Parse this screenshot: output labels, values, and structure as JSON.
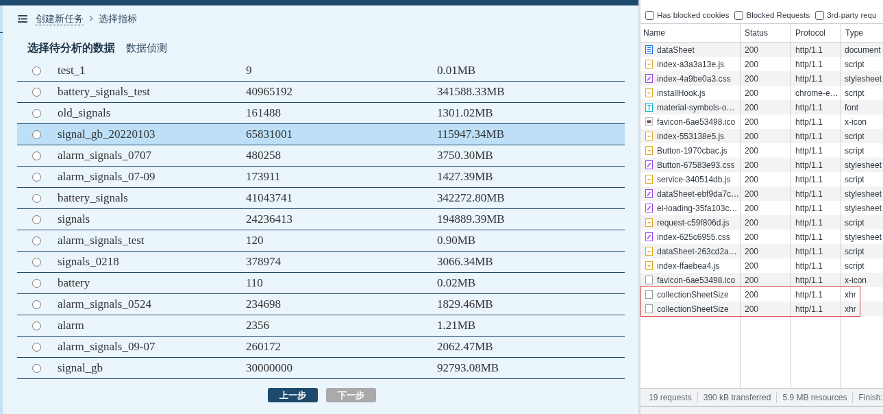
{
  "breadcrumb": [
    {
      "label": "创建新任务",
      "kind": "link"
    },
    {
      "label": "选择指标",
      "kind": "current"
    }
  ],
  "section_tabs": [
    {
      "label": "选择待分析的数据",
      "selected": true
    },
    {
      "label": "数据侦测",
      "selected": false
    }
  ],
  "datasets": [
    {
      "name": "test_1",
      "count": "9",
      "size": "0.01MB",
      "selected": false
    },
    {
      "name": "battery_signals_test",
      "count": "40965192",
      "size": "341588.33MB",
      "selected": false
    },
    {
      "name": "old_signals",
      "count": "161488",
      "size": "1301.02MB",
      "selected": false
    },
    {
      "name": "signal_gb_20220103",
      "count": "65831001",
      "size": "115947.34MB",
      "selected": true
    },
    {
      "name": "alarm_signals_0707",
      "count": "480258",
      "size": "3750.30MB",
      "selected": false
    },
    {
      "name": "alarm_signals_07-09",
      "count": "173911",
      "size": "1427.39MB",
      "selected": false
    },
    {
      "name": "battery_signals",
      "count": "41043741",
      "size": "342272.80MB",
      "selected": false
    },
    {
      "name": "signals",
      "count": "24236413",
      "size": "194889.39MB",
      "selected": false
    },
    {
      "name": "alarm_signals_test",
      "count": "120",
      "size": "0.90MB",
      "selected": false
    },
    {
      "name": "signals_0218",
      "count": "378974",
      "size": "3066.34MB",
      "selected": false
    },
    {
      "name": "battery",
      "count": "110",
      "size": "0.02MB",
      "selected": false
    },
    {
      "name": "alarm_signals_0524",
      "count": "234698",
      "size": "1829.46MB",
      "selected": false
    },
    {
      "name": "alarm",
      "count": "2356",
      "size": "1.21MB",
      "selected": false
    },
    {
      "name": "alarm_signals_09-07",
      "count": "260172",
      "size": "2062.47MB",
      "selected": false
    },
    {
      "name": "signal_gb",
      "count": "30000000",
      "size": "92793.08MB",
      "selected": false
    }
  ],
  "buttons": [
    {
      "label": "上一步",
      "disabled": false
    },
    {
      "label": "下一步",
      "disabled": true
    }
  ],
  "devtools": {
    "filters": [
      {
        "label": "Has blocked cookies",
        "checked": false
      },
      {
        "label": "Blocked Requests",
        "checked": false
      },
      {
        "label": "3rd-party requ",
        "checked": false
      }
    ],
    "columns": [
      "Name",
      "Status",
      "Protocol",
      "Type"
    ],
    "requests": [
      {
        "name": "dataSheet",
        "status": "200",
        "protocol": "http/1.1",
        "type": "document",
        "kind": "document",
        "marked": false
      },
      {
        "name": "index-a3a3a13e.js",
        "status": "200",
        "protocol": "http/1.1",
        "type": "script",
        "kind": "script",
        "marked": false
      },
      {
        "name": "index-4a9be0a3.css",
        "status": "200",
        "protocol": "http/1.1",
        "type": "stylesheet",
        "kind": "stylesheet",
        "marked": false
      },
      {
        "name": "installHook.js",
        "status": "200",
        "protocol": "chrome-e…",
        "type": "script",
        "kind": "script",
        "marked": false
      },
      {
        "name": "material-symbols-o…",
        "status": "200",
        "protocol": "http/1.1",
        "type": "font",
        "kind": "font",
        "marked": false
      },
      {
        "name": "favicon-6ae53498.ico",
        "status": "200",
        "protocol": "http/1.1",
        "type": "x-icon",
        "kind": "image",
        "marked": false
      },
      {
        "name": "index-553138e5.js",
        "status": "200",
        "protocol": "http/1.1",
        "type": "script",
        "kind": "script",
        "marked": false
      },
      {
        "name": "Button-1970cbac.js",
        "status": "200",
        "protocol": "http/1.1",
        "type": "script",
        "kind": "script",
        "marked": false
      },
      {
        "name": "Button-67583e93.css",
        "status": "200",
        "protocol": "http/1.1",
        "type": "stylesheet",
        "kind": "stylesheet",
        "marked": false
      },
      {
        "name": "service-340514db.js",
        "status": "200",
        "protocol": "http/1.1",
        "type": "script",
        "kind": "script",
        "marked": false
      },
      {
        "name": "dataSheet-ebf9da7c…",
        "status": "200",
        "protocol": "http/1.1",
        "type": "stylesheet",
        "kind": "stylesheet",
        "marked": false
      },
      {
        "name": "el-loading-35fa103c…",
        "status": "200",
        "protocol": "http/1.1",
        "type": "stylesheet",
        "kind": "stylesheet",
        "marked": false
      },
      {
        "name": "request-c59f806d.js",
        "status": "200",
        "protocol": "http/1.1",
        "type": "script",
        "kind": "script",
        "marked": false
      },
      {
        "name": "index-625c6955.css",
        "status": "200",
        "protocol": "http/1.1",
        "type": "stylesheet",
        "kind": "stylesheet",
        "marked": false
      },
      {
        "name": "dataSheet-263cd2a…",
        "status": "200",
        "protocol": "http/1.1",
        "type": "script",
        "kind": "script",
        "marked": false
      },
      {
        "name": "index-ffaebea4.js",
        "status": "200",
        "protocol": "http/1.1",
        "type": "script",
        "kind": "script",
        "marked": false
      },
      {
        "name": "favicon-6ae53498.ico",
        "status": "200",
        "protocol": "http/1.1",
        "type": "x-icon",
        "kind": "blank",
        "marked": false
      },
      {
        "name": "collectionSheetSize",
        "status": "200",
        "protocol": "http/1.1",
        "type": "xhr",
        "kind": "blank",
        "marked": true
      },
      {
        "name": "collectionSheetSize",
        "status": "200",
        "protocol": "http/1.1",
        "type": "xhr",
        "kind": "blank",
        "marked": true
      }
    ],
    "status_bar": [
      "19 requests",
      "390 kB transferred",
      "5.9 MB resources",
      "Finish:"
    ]
  }
}
